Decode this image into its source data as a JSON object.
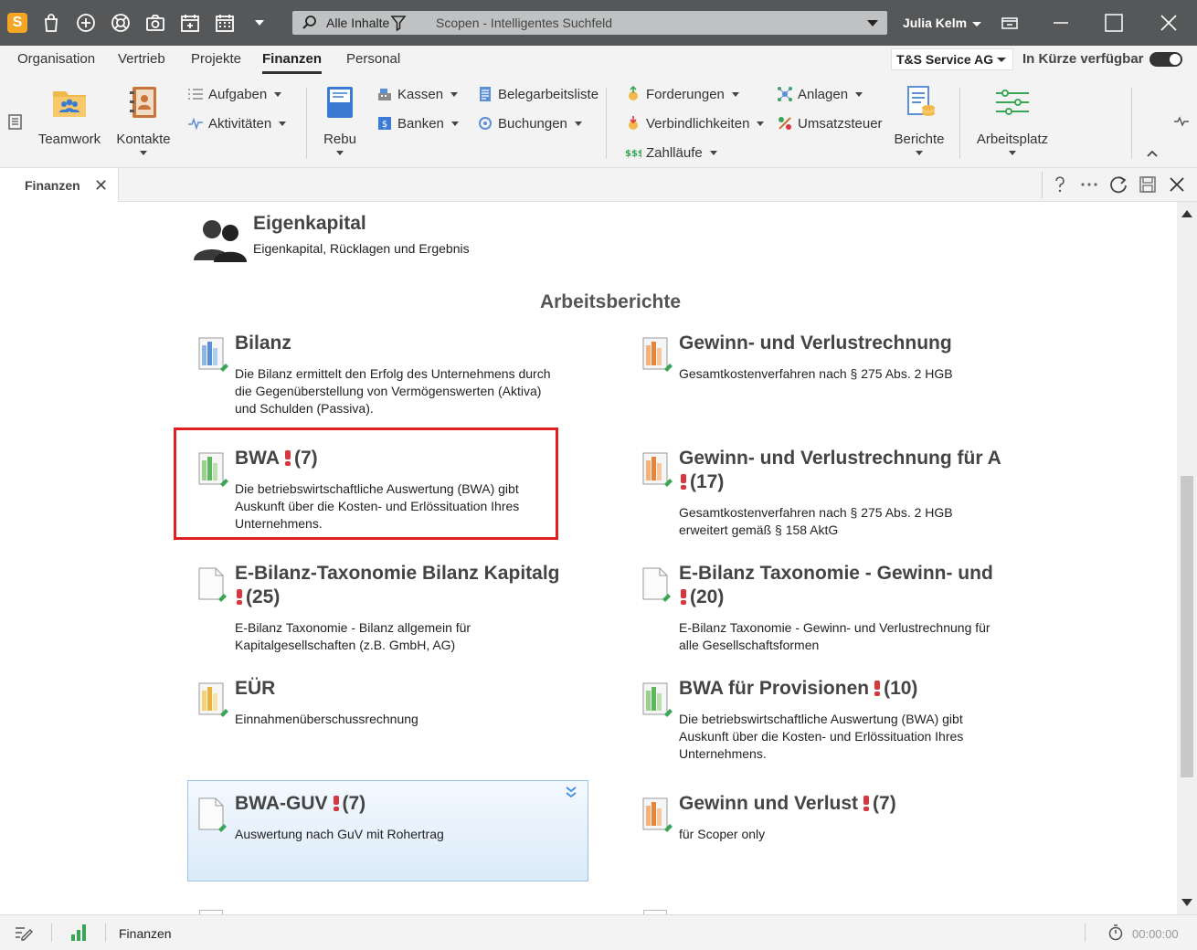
{
  "titlebar": {
    "logo_letter": "S",
    "search_scope": "Alle Inhalte",
    "search_placeholder": "Scopen - Intelligentes Suchfeld",
    "user_name": "Julia Kelm",
    "accent_color": "#f5a623"
  },
  "menu": {
    "tabs": [
      "Organisation",
      "Vertrieb",
      "Projekte",
      "Finanzen",
      "Personal"
    ],
    "active_tab": "Finanzen",
    "company": "T&S Service AG",
    "availability_label": "In Kürze verfügbar"
  },
  "ribbon": {
    "teamwork": "Teamwork",
    "kontakte": "Kontakte",
    "aufgaben": "Aufgaben",
    "aktivitaeten": "Aktivitäten",
    "rebu": "Rebu",
    "kassen": "Kassen",
    "banken": "Banken",
    "belegarbeitsliste": "Belegarbeitsliste",
    "buchungen": "Buchungen",
    "forderungen": "Forderungen",
    "verbindlichkeiten": "Verbindlichkeiten",
    "zahllaeufe": "Zahlläufe",
    "anlagen": "Anlagen",
    "umsatzsteuer": "Umsatzsteuer",
    "berichte": "Berichte",
    "arbeitsplatz": "Arbeitsplatz"
  },
  "doc_tab": {
    "label": "Finanzen",
    "close": "✕"
  },
  "content": {
    "eigenkapital": {
      "title": "Eigenkapital",
      "description": "Eigenkapital, Rücklagen und Ergebnis"
    },
    "section_title": "Arbeitsberichte",
    "reports": [
      {
        "title": "Bilanz",
        "count": "",
        "desc": [
          "Die Bilanz ermittelt den Erfolg des Unternehmens durch",
          "die Gegenüberstellung von Vermögenswerten (Aktiva)",
          "und Schulden (Passiva)."
        ]
      },
      {
        "title": "Gewinn- und Verlustrechnung",
        "count": "",
        "desc": [
          "Gesamtkostenverfahren nach § 275 Abs. 2 HGB"
        ]
      },
      {
        "title": "BWA",
        "count": "(7)",
        "desc": [
          "Die betriebswirtschaftliche Auswertung (BWA) gibt",
          "Auskunft über die Kosten- und Erlössituation Ihres",
          "Unternehmens."
        ]
      },
      {
        "title": "Gewinn- und Verlustrechnung für A",
        "count": "(17)",
        "desc": [
          "Gesamtkostenverfahren nach § 275 Abs. 2 HGB",
          "erweitert gemäß § 158 AktG"
        ]
      },
      {
        "title": "E-Bilanz-Taxonomie Bilanz Kapitalg",
        "count": "(25)",
        "desc": [
          "E-Bilanz Taxonomie - Bilanz allgemein für",
          "Kapitalgesellschaften (z.B. GmbH, AG)"
        ]
      },
      {
        "title": "E-Bilanz Taxonomie - Gewinn- und",
        "count": "(20)",
        "desc": [
          "E-Bilanz Taxonomie - Gewinn- und Verlustrechnung für",
          "alle Gesellschaftsformen"
        ]
      },
      {
        "title": "EÜR",
        "count": "",
        "desc": [
          "Einnahmenüberschussrechnung"
        ]
      },
      {
        "title": "BWA für Provisionen",
        "count": "(10)",
        "desc": [
          "Die betriebswirtschaftliche Auswertung (BWA) gibt",
          "Auskunft über die Kosten- und Erlössituation Ihres",
          "Unternehmens."
        ]
      },
      {
        "title": "BWA-GUV",
        "count": "(7)",
        "desc": [
          "Auswertung nach GuV mit Rohertrag"
        ]
      },
      {
        "title": "Gewinn und Verlust",
        "count": "(7)",
        "desc": [
          "für Scoper only"
        ]
      }
    ]
  },
  "statusbar": {
    "label": "Finanzen",
    "timer": "00:00:00"
  }
}
